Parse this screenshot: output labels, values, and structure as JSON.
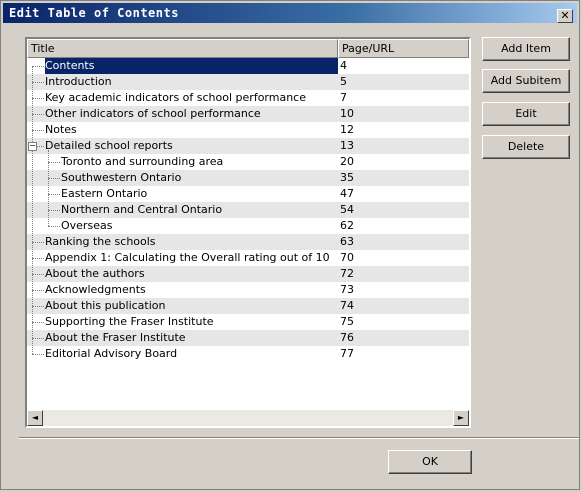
{
  "window": {
    "title": "Edit Table of Contents",
    "close_glyph": "✕"
  },
  "list": {
    "columns": {
      "title": "Title",
      "page": "Page/URL"
    },
    "rows": [
      {
        "title": "Contents",
        "page": "4",
        "level": 0
      },
      {
        "title": "Introduction",
        "page": "5",
        "level": 0
      },
      {
        "title": "Key academic indicators of school performance",
        "page": "7",
        "level": 0
      },
      {
        "title": "Other indicators of school performance",
        "page": "10",
        "level": 0
      },
      {
        "title": "Notes",
        "page": "12",
        "level": 0
      },
      {
        "title": "Detailed school reports",
        "page": "13",
        "level": 0
      },
      {
        "title": "Toronto and surrounding area",
        "page": "20",
        "level": 1
      },
      {
        "title": "Southwestern Ontario",
        "page": "35",
        "level": 1
      },
      {
        "title": "Eastern Ontario",
        "page": "47",
        "level": 1
      },
      {
        "title": "Northern and Central Ontario",
        "page": "54",
        "level": 1
      },
      {
        "title": "Overseas",
        "page": "62",
        "level": 1
      },
      {
        "title": "Ranking the schools",
        "page": "63",
        "level": 0
      },
      {
        "title": "Appendix 1: Calculating the Overall rating out of 10",
        "page": "70",
        "level": 0
      },
      {
        "title": "About the authors",
        "page": "72",
        "level": 0
      },
      {
        "title": "Acknowledgments",
        "page": "73",
        "level": 0
      },
      {
        "title": "About this publication",
        "page": "74",
        "level": 0
      },
      {
        "title": "Supporting the Fraser Institute",
        "page": "75",
        "level": 0
      },
      {
        "title": "About the Fraser Institute",
        "page": "76",
        "level": 0
      },
      {
        "title": "Editorial Advisory Board",
        "page": "77",
        "level": 0
      }
    ],
    "selected_index": 0,
    "expanded_node": "Detailed school reports",
    "scroll_left_glyph": "◄",
    "scroll_right_glyph": "►"
  },
  "buttons": {
    "add_item": "Add Item",
    "add_subitem": "Add Subitem",
    "edit": "Edit",
    "delete": "Delete",
    "ok": "OK"
  },
  "colors": {
    "selection": "#0a246a",
    "title_bar": "#0a246a"
  }
}
